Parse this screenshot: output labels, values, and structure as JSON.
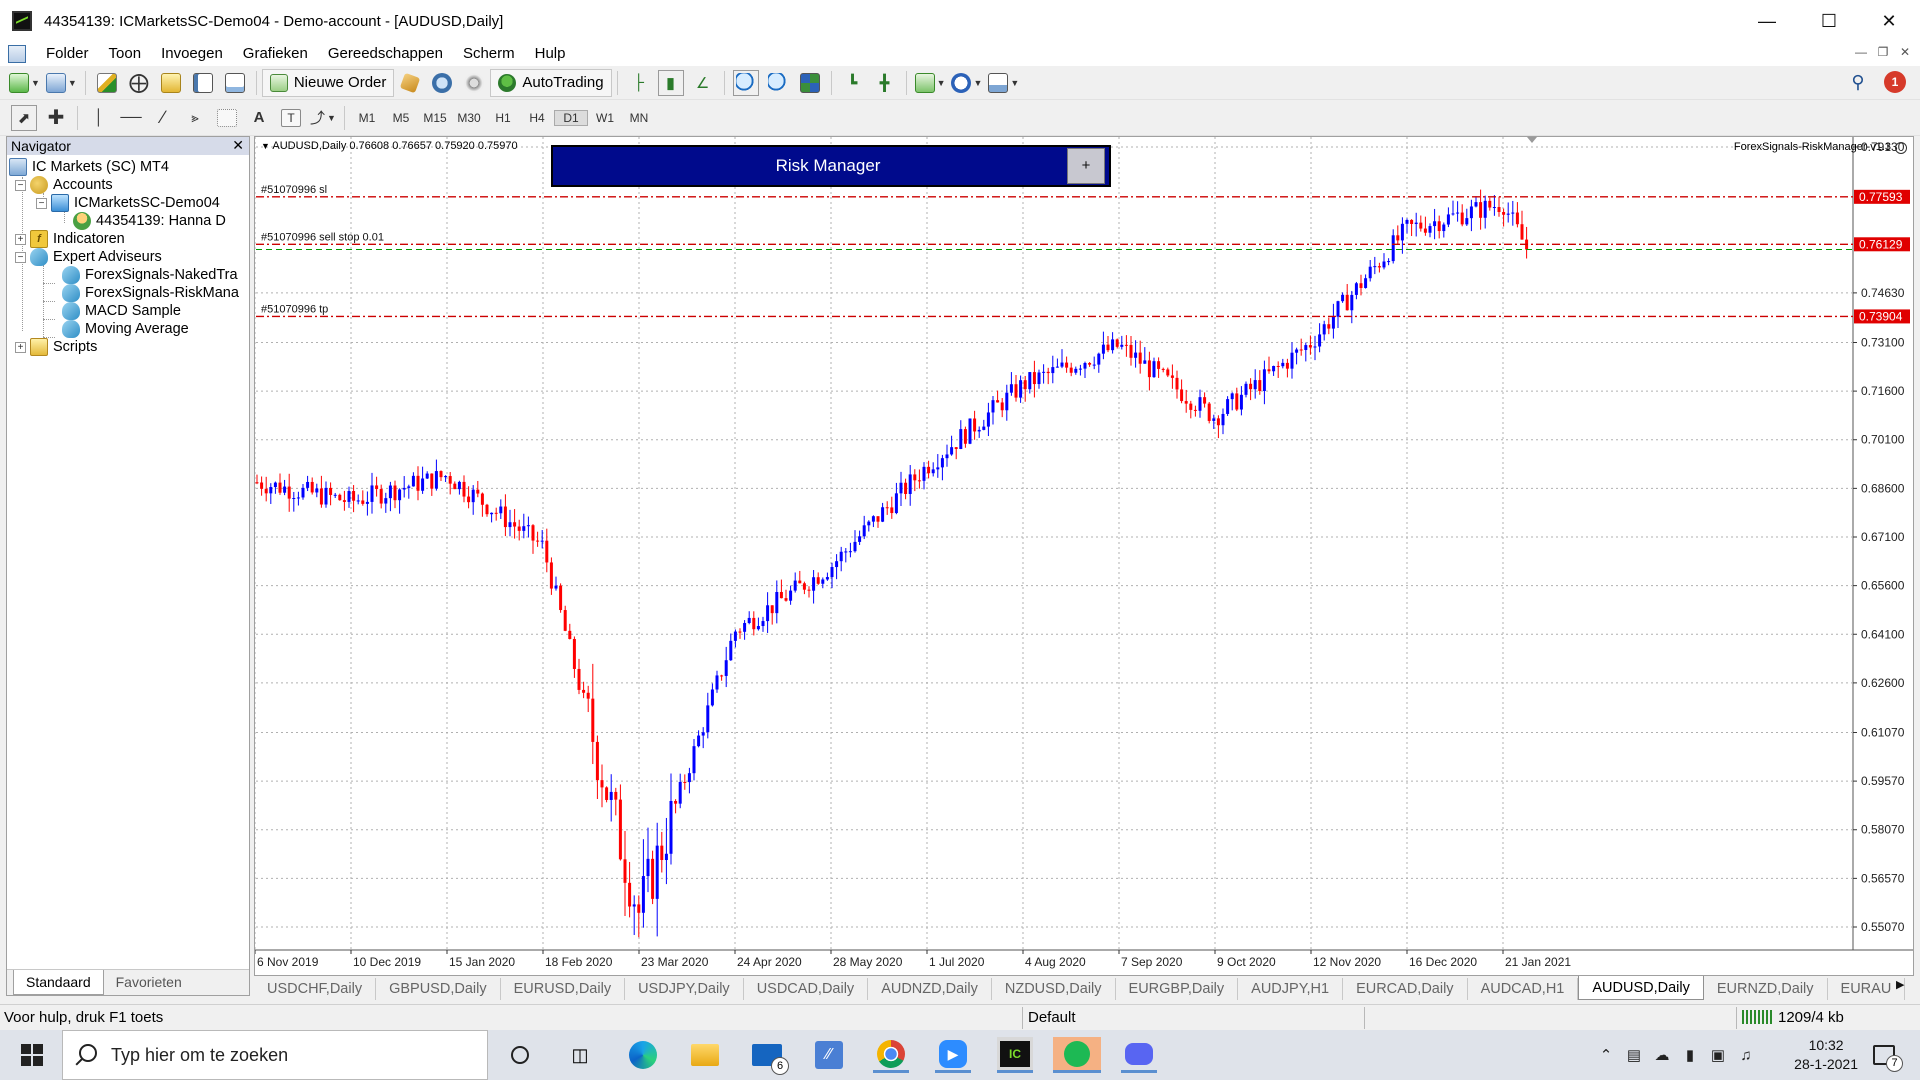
{
  "window": {
    "title": "44354139: ICMarketsSC-Demo04 - Demo-account - [AUDUSD,Daily]",
    "controls": [
      "—",
      "☐",
      "✕"
    ]
  },
  "menu": [
    "Folder",
    "Toon",
    "Invoegen",
    "Grafieken",
    "Gereedschappen",
    "Scherm",
    "Hulp"
  ],
  "toolbar": {
    "new_order_label": "Nieuwe Order",
    "autotrading_label": "AutoTrading",
    "notification_count": "1"
  },
  "timeframes": [
    "M1",
    "M5",
    "M15",
    "M30",
    "H1",
    "H4",
    "D1",
    "W1",
    "MN"
  ],
  "active_timeframe": "D1",
  "navigator": {
    "title": "Navigator",
    "rows": [
      {
        "label": "IC Markets (SC) MT4",
        "icon": "terminal-icon"
      },
      {
        "label": "Accounts",
        "icon": "accounts-icon"
      },
      {
        "label": "ICMarketsSC-Demo04",
        "icon": "server-icon"
      },
      {
        "label": "44354139: Hanna D",
        "icon": "user-icon"
      },
      {
        "label": "Indicatoren",
        "icon": "indicators-icon"
      },
      {
        "label": "Expert Adviseurs",
        "icon": "experts-icon"
      },
      {
        "label": "ForexSignals-NakedTra",
        "icon": "expert-icon"
      },
      {
        "label": "ForexSignals-RiskMana",
        "icon": "expert-icon"
      },
      {
        "label": "MACD Sample",
        "icon": "expert-icon"
      },
      {
        "label": "Moving Average",
        "icon": "expert-icon"
      },
      {
        "label": "Scripts",
        "icon": "scripts-icon"
      }
    ],
    "tabs": [
      "Standaard",
      "Favorieten"
    ]
  },
  "chart": {
    "info_text": "AUDUSD,Daily  0.76608 0.76657 0.75920 0.75970",
    "risk_manager_title": "Risk Manager",
    "risk_manager_button": "+",
    "ea_label": "ForexSignals-RiskManager-v1.3",
    "order_lines": [
      {
        "label": "#51070996 sl",
        "price": 0.77593,
        "color": "#cc0000"
      },
      {
        "label": "#51070996 sell stop 0.01",
        "price": 0.76129,
        "color": "#cc0000"
      },
      {
        "label": "#51070996 tp",
        "price": 0.73904,
        "color": "#cc0000"
      }
    ],
    "bid_line_price": 0.7597,
    "price_ticks": [
      "0.79130",
      "0.74630",
      "0.73100",
      "0.71600",
      "0.70100",
      "0.68600",
      "0.67100",
      "0.65600",
      "0.64100",
      "0.62600",
      "0.61070",
      "0.59570",
      "0.58070",
      "0.56570",
      "0.55070"
    ],
    "date_ticks": [
      "6 Nov 2019",
      "10 Dec 2019",
      "15 Jan 2020",
      "18 Feb 2020",
      "23 Mar 2020",
      "24 Apr 2020",
      "28 May 2020",
      "1 Jul 2020",
      "4 Aug 2020",
      "7 Sep 2020",
      "9 Oct 2020",
      "12 Nov 2020",
      "16 Dec 2020",
      "21 Jan 2021"
    ],
    "colors": {
      "bull": "#0000ff",
      "bear": "#ff0000",
      "grid": "#b0b0b0"
    }
  },
  "chart_data": {
    "type": "candlestick",
    "symbol": "AUDUSD",
    "timeframe": "Daily",
    "x": [
      "6 Nov 2019",
      "10 Dec 2019",
      "15 Jan 2020",
      "18 Feb 2020",
      "23 Mar 2020",
      "24 Apr 2020",
      "28 May 2020",
      "1 Jul 2020",
      "4 Aug 2020",
      "7 Sep 2020",
      "9 Oct 2020",
      "12 Nov 2020",
      "16 Dec 2020",
      "21 Jan 2021",
      "28 Jan 2021"
    ],
    "y": [
      0.688,
      0.682,
      0.69,
      0.668,
      0.555,
      0.642,
      0.662,
      0.693,
      0.718,
      0.73,
      0.708,
      0.731,
      0.766,
      0.774,
      0.7597
    ],
    "ylim": [
      0.5507,
      0.7913
    ],
    "grid": true
  },
  "chart_tabs": [
    "USDCHF,Daily",
    "GBPUSD,Daily",
    "EURUSD,Daily",
    "USDJPY,Daily",
    "USDCAD,Daily",
    "AUDNZD,Daily",
    "NZDUSD,Daily",
    "EURGBP,Daily",
    "AUDJPY,H1",
    "EURCAD,Daily",
    "AUDCAD,H1",
    "AUDUSD,Daily",
    "EURNZD,Daily",
    "EURAU"
  ],
  "active_chart_tab": "AUDUSD,Daily",
  "status": {
    "help": "Voor hulp, druk F1 toets",
    "profile": "Default",
    "traffic": "1209/4 kb"
  },
  "taskbar": {
    "search_placeholder": "Typ hier om te zoeken",
    "mail_badge": "6",
    "time": "10:32",
    "date": "28-1-2021",
    "notification_count": "7"
  }
}
